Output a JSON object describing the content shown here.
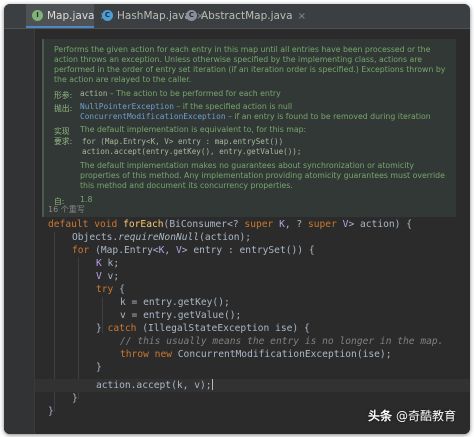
{
  "tabs": [
    {
      "label": "Map.java",
      "icon": "interface-icon",
      "active": true
    },
    {
      "label": "HashMap.java",
      "icon": "class-icon",
      "active": false
    },
    {
      "label": "AbstractMap.java",
      "icon": "abstract-class-icon",
      "active": false
    }
  ],
  "javadoc": {
    "description": [
      "Performs the given action for each entry in this map until all entries have been processed or the",
      "action throws an exception. Unless otherwise specified by the implementing class, actions are",
      "performed in the order of entry set iteration (if an iteration order is specified.) Exceptions thrown by",
      "the action are relayed to the caller."
    ],
    "params_label": "形参:",
    "params_name": "action",
    "params_desc": " – The action to be performed for each entry",
    "throws_label": "抛出:",
    "throws": [
      {
        "name": "NullPointerException",
        "desc": " – if the specified action is null"
      },
      {
        "name": "ConcurrentModificationException",
        "desc": " – if an entry is found to be removed during iteration"
      }
    ],
    "impl_label_1": "实现",
    "impl_label_2": "要求:",
    "impl_desc": "The default implementation is equivalent to, for this map:",
    "impl_code": [
      "for (Map.Entry<K, V> entry : map.entrySet())",
      "    action.accept(entry.getKey(), entry.getValue());"
    ],
    "impl_note": [
      "The default implementation makes no guarantees about synchronization or atomicity",
      "properties of this method. Any implementation providing atomicity guarantees must override",
      "this method and document its concurrency properties."
    ],
    "since_label": "自:",
    "since_value": "1.8"
  },
  "override_hint": "16 个重写",
  "code": {
    "l1_kw1": "default",
    "l1_kw2": "void",
    "l1_fn": "forEach",
    "l1_a": "(BiConsumer<?",
    "l1_kw3": "super",
    "l1_k": "K",
    "l1_b": ", ?",
    "l1_kw4": "super",
    "l1_v": "V",
    "l1_c": "> action) {",
    "l2_a": "Objects.",
    "l2_b": "requireNonNull",
    "l2_c": "(action);",
    "l3_kw": "for",
    "l3_a": " (Map.Entry<",
    "l3_k": "K",
    "l3_b": ", ",
    "l3_v": "V",
    "l3_c": "> entry : entrySet()) {",
    "l4_t": "K",
    "l4_a": " k;",
    "l5_t": "V",
    "l5_a": " v;",
    "l6_kw": "try",
    "l6_a": " {",
    "l7": "k = entry.getKey();",
    "l8": "v = entry.getValue();",
    "l9_a": "} ",
    "l9_kw": "catch",
    "l9_b": " (IllegalStateException ise) {",
    "l10": "// this usually means the entry is no longer in the map.",
    "l11_kw1": "throw",
    "l11_kw2": "new",
    "l11_a": " ConcurrentModificationException(ise);",
    "l12": "}",
    "l13": "action.accept(k, v);",
    "l14": "}",
    "l15": "}"
  },
  "watermark": {
    "mark": "头条",
    "text": "@奇酷教育"
  },
  "colors": {
    "background": "#2b2b2b",
    "keyword": "#cc7832",
    "method": "#ffc66d",
    "doc": "#76a66d",
    "active_tab_underline": "#4a88c7"
  }
}
